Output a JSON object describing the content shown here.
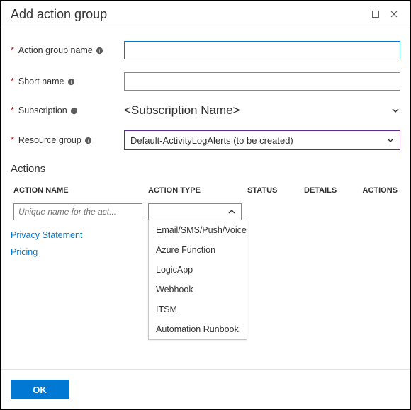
{
  "window": {
    "title": "Add action group"
  },
  "fields": {
    "action_group_name": {
      "label": "Action group name",
      "value": ""
    },
    "short_name": {
      "label": "Short name",
      "value": ""
    },
    "subscription": {
      "label": "Subscription",
      "value": "<Subscription Name>"
    },
    "resource_group": {
      "label": "Resource group",
      "value": "Default-ActivityLogAlerts (to be created)"
    }
  },
  "actions": {
    "header": "Actions",
    "columns": {
      "name": "ACTION NAME",
      "type": "ACTION TYPE",
      "status": "STATUS",
      "details": "DETAILS",
      "actions": "ACTIONS"
    },
    "row": {
      "name_placeholder": "Unique name for the act...",
      "type_options": [
        "Email/SMS/Push/Voice",
        "Azure Function",
        "LogicApp",
        "Webhook",
        "ITSM",
        "Automation Runbook"
      ]
    }
  },
  "links": {
    "privacy": "Privacy Statement",
    "pricing": "Pricing"
  },
  "footer": {
    "ok": "OK"
  }
}
